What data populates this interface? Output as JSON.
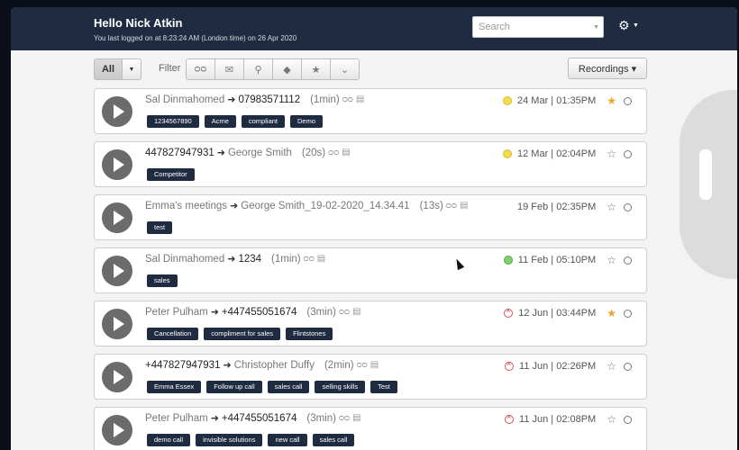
{
  "header": {
    "greeting": "Hello Nick Atkin",
    "last_logged": "You last logged on at 8:23:24 AM (London time) on 26 Apr 2020",
    "search_placeholder": "Search"
  },
  "toolbar": {
    "all_label": "All",
    "filter_label": "Filter",
    "filter_icons": [
      "voicemail-icon",
      "envelope-icon",
      "map-marker-icon",
      "tag-icon",
      "star-icon",
      "chevron-down-icon"
    ],
    "recordings_label": "Recordings ▾"
  },
  "recordings": [
    {
      "from": "Sal Dinmahomed",
      "to": "07983571112",
      "duration": "(1min)",
      "date": "24 Mar | 01:35PM",
      "status": "yellow",
      "starred": true,
      "tags": [
        "1234567890",
        "Acme",
        "compliant",
        "Demo"
      ]
    },
    {
      "from": "447827947931",
      "to": "George Smith",
      "duration": "(20s)",
      "date": "12 Mar | 02:04PM",
      "status": "yellow",
      "starred": false,
      "tags": [
        "Competitor"
      ]
    },
    {
      "from": "Emma's meetings",
      "to": "George Smith_19-02-2020_14.34.41",
      "duration": "(13s)",
      "date": "19 Feb | 02:35PM",
      "status": "none",
      "starred": false,
      "tags": [
        "test"
      ]
    },
    {
      "from": "Sal Dinmahomed",
      "to": "1234",
      "duration": "(1min)",
      "date": "11 Feb | 05:10PM",
      "status": "green",
      "starred": false,
      "tags": [
        "sales"
      ]
    },
    {
      "from": "Peter Pulham",
      "to": "+447455051674",
      "duration": "(3min)",
      "date": "12 Jun | 03:44PM",
      "status": "red",
      "starred": true,
      "tags": [
        "Cancellation",
        "compliment for sales",
        "Flintstones"
      ]
    },
    {
      "from": "+447827947931",
      "to": "Christopher Duffy",
      "duration": "(2min)",
      "date": "11 Jun | 02:26PM",
      "status": "red",
      "starred": false,
      "tags": [
        "Emma Essex",
        "Follow up call",
        "sales call",
        "selling skills",
        "Test"
      ]
    },
    {
      "from": "Peter Pulham",
      "to": "+447455051674",
      "duration": "(3min)",
      "date": "11 Jun | 02:08PM",
      "status": "red",
      "starred": false,
      "tags": [
        "demo call",
        "invisible solutions",
        "new call",
        "sales call"
      ]
    }
  ]
}
